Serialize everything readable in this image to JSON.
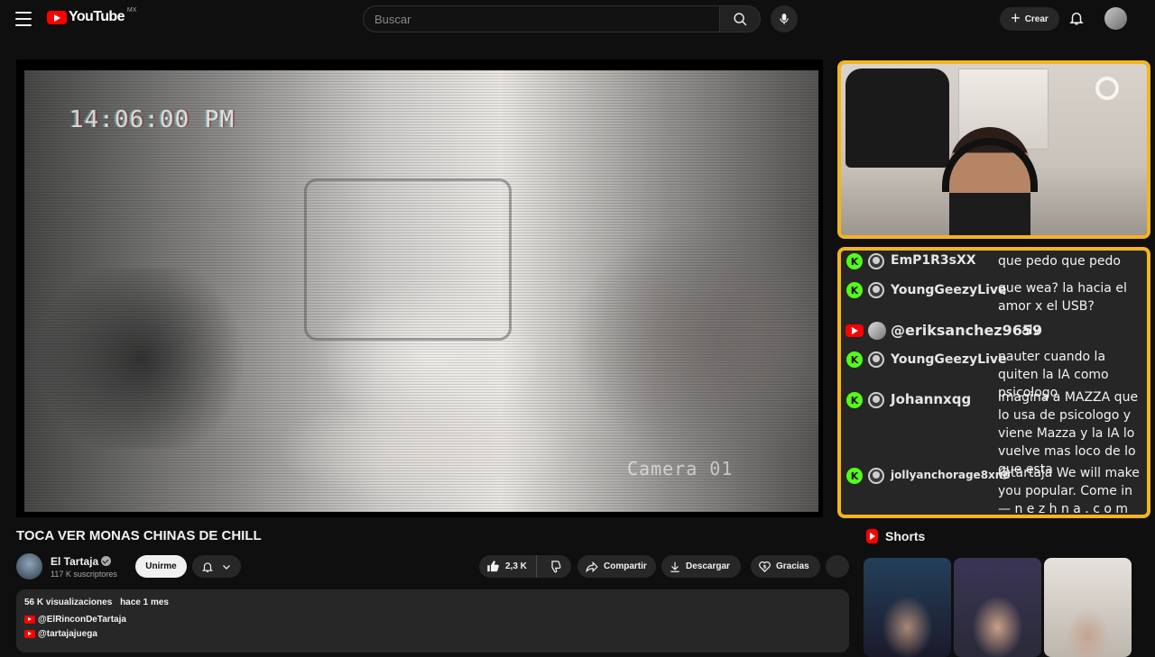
{
  "header": {
    "logo_text": "YouTube",
    "country": "MX",
    "search_placeholder": "Buscar",
    "create_label": "Crear"
  },
  "video": {
    "overlay_time": "14:06:00 PM",
    "overlay_camera": "Camera 01",
    "title": "TOCA VER MONAS CHINAS DE CHILL"
  },
  "chat": {
    "messages": [
      {
        "platform": "kick",
        "user": "EmP1R3sXX",
        "text": "que pedo que pedo"
      },
      {
        "platform": "kick",
        "user": "YoungGeezyLive",
        "text": "que wea? la hacia el amor x el USB?"
      },
      {
        "platform": "youtube",
        "user": "@eriksanchez9659",
        "text": "alv"
      },
      {
        "platform": "kick",
        "user": "YoungGeezyLive",
        "text": "nauter cuando la quiten la IA como psicologo"
      },
      {
        "platform": "kick",
        "user": "Johannxqg",
        "text": "imagina a MAZZA que lo usa de psicologo y viene Mazza y la IA lo vuelve mas loco de lo que esta"
      },
      {
        "platform": "kick",
        "user": "jollyanchorage8xno",
        "text": "@tartaja We will make you popular. Come in — n e z h n a . c o m"
      }
    ]
  },
  "channel": {
    "name": "El Tartaja",
    "subscribers": "117 K suscriptores",
    "join_label": "Unirme"
  },
  "actions": {
    "likes": "2,3 K",
    "share": "Compartir",
    "download": "Descargar",
    "thanks": "Gracias"
  },
  "description": {
    "views": "56 K visualizaciones",
    "date": "hace 1 mes",
    "links": [
      "@ElRinconDeTartaja",
      "@tartajajuega"
    ]
  },
  "shorts": {
    "label": "Shorts"
  },
  "colors": {
    "background": "#0f0f0f",
    "accent_red": "#ff0000",
    "overlay_border": "#f2b51e",
    "kick_green": "#53fc18"
  }
}
